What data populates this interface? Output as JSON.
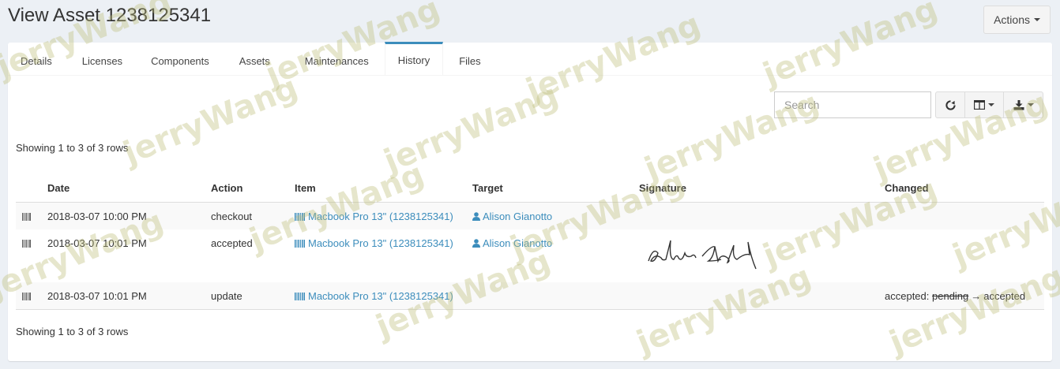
{
  "page": {
    "title": "View Asset 1238125341",
    "actions_label": "Actions"
  },
  "tabs": [
    {
      "label": "Details"
    },
    {
      "label": "Licenses"
    },
    {
      "label": "Components"
    },
    {
      "label": "Assets"
    },
    {
      "label": "Maintenances"
    },
    {
      "label": "History",
      "active": true
    },
    {
      "label": "Files"
    }
  ],
  "toolbar": {
    "search_placeholder": "Search",
    "refresh_icon": "refresh-icon",
    "columns_icon": "columns-icon",
    "export_icon": "download-icon"
  },
  "table": {
    "rows_info_top": "Showing 1 to 3 of 3 rows",
    "rows_info_bottom": "Showing 1 to 3 of 3 rows",
    "headers": {
      "date": "Date",
      "action": "Action",
      "item": "Item",
      "target": "Target",
      "signature": "Signature",
      "changed": "Changed"
    },
    "rows": [
      {
        "date": "2018-03-07 10:00 PM",
        "action": "checkout",
        "item": "Macbook Pro 13\" (1238125341)",
        "target": "Alison Gianotto",
        "changed_prefix": "",
        "changed_old": "",
        "changed_arrow": "",
        "changed_new": ""
      },
      {
        "date": "2018-03-07 10:01 PM",
        "action": "accepted",
        "item": "Macbook Pro 13\" (1238125341)",
        "target": "Alison Gianotto",
        "signature": "signature-image",
        "changed_prefix": "",
        "changed_old": "",
        "changed_arrow": "",
        "changed_new": ""
      },
      {
        "date": "2018-03-07 10:01 PM",
        "action": "update",
        "item": "Macbook Pro 13\" (1238125341)",
        "target": "",
        "changed_prefix": "accepted: ",
        "changed_old": "pending",
        "changed_arrow": "→",
        "changed_new": "accepted"
      }
    ]
  },
  "watermark": {
    "text": "jerryWang"
  },
  "colors": {
    "link": "#3c8dbc",
    "background": "#ecf0f5",
    "active_tab_border": "#3c8dbc"
  }
}
